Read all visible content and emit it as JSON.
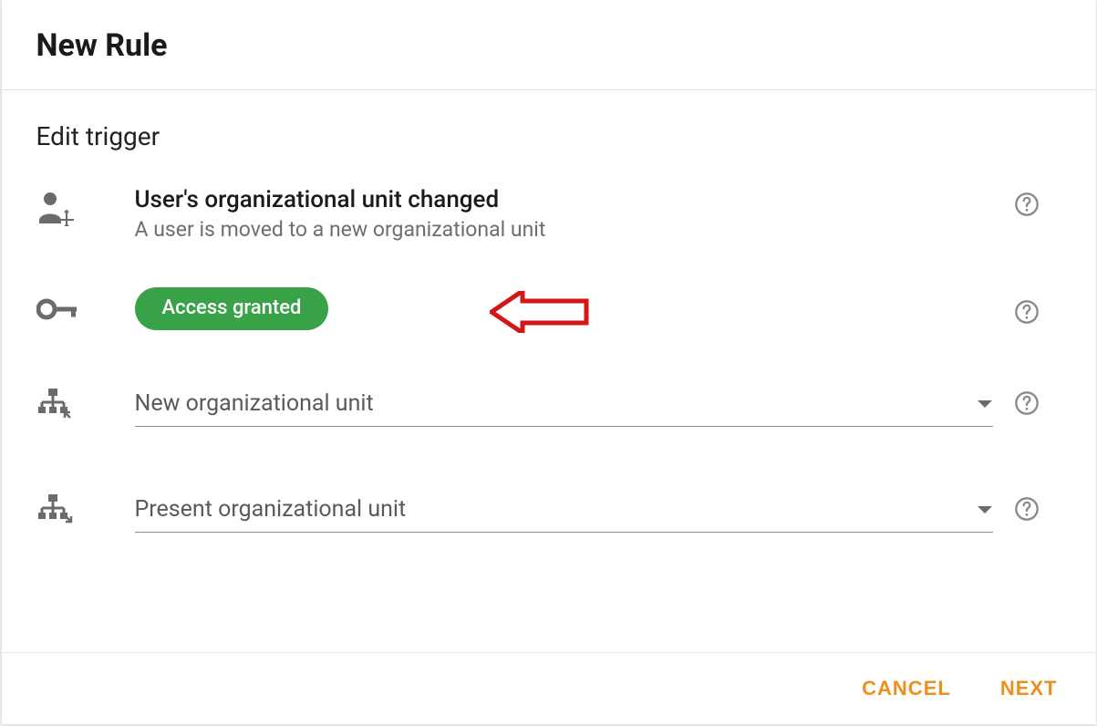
{
  "header": {
    "title": "New Rule"
  },
  "section": {
    "heading": "Edit trigger"
  },
  "trigger": {
    "title": "User's organizational unit changed",
    "subtitle": "A user is moved to a new organizational unit"
  },
  "access": {
    "chip_label": "Access granted"
  },
  "fields": {
    "new_ou": {
      "label": "New organizational unit"
    },
    "present_ou": {
      "label": "Present organizational unit"
    }
  },
  "footer": {
    "cancel": "CANCEL",
    "next": "NEXT"
  },
  "colors": {
    "accent": "#ee8f1d",
    "chip": "#39a249",
    "annotation": "#d31616"
  }
}
